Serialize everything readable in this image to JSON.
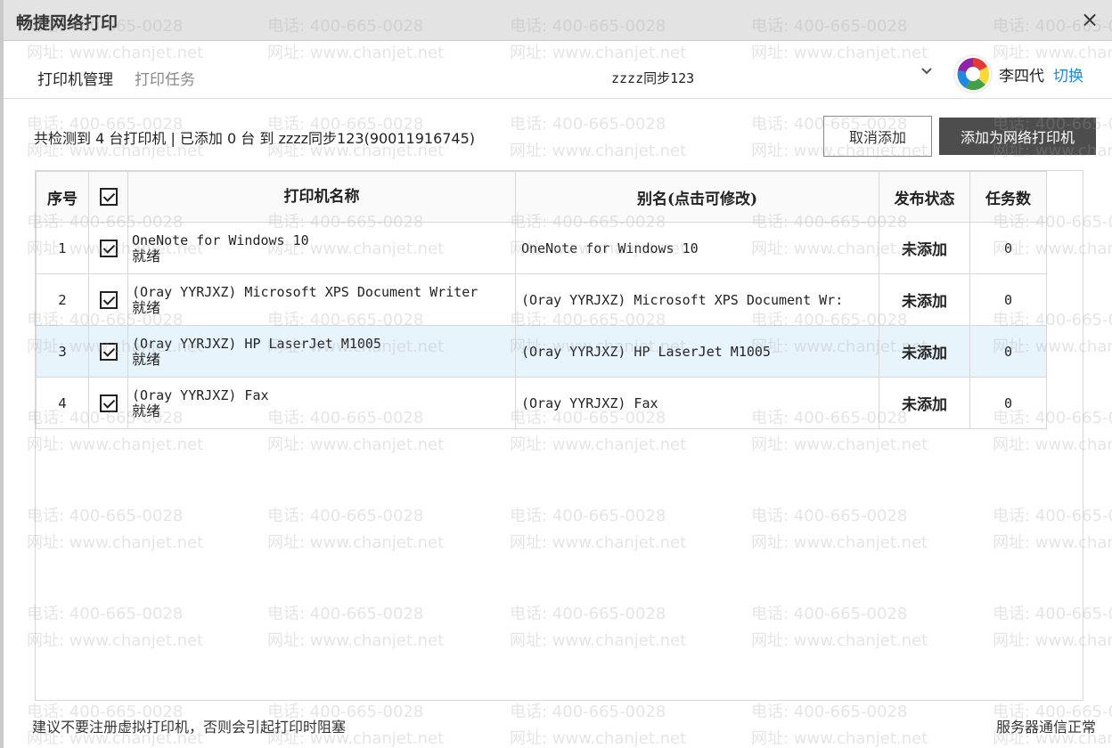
{
  "window": {
    "title": "畅捷网络打印",
    "close_glyph": "×"
  },
  "nav": {
    "tabs": [
      {
        "label": "打印机管理",
        "active": true
      },
      {
        "label": "打印任务",
        "active": false
      }
    ],
    "account": "zzzz同步123",
    "user_name": "李四代",
    "switch_label": "切换"
  },
  "summary": {
    "text": "共检测到 4 台打印机 | 已添加 0 台 到 zzzz同步123(90011916745)"
  },
  "actions": {
    "cancel_label": "取消添加",
    "add_label": "添加为网络打印机"
  },
  "table": {
    "headers": {
      "index": "序号",
      "name": "打印机名称",
      "alias": "别名(点击可修改)",
      "status": "发布状态",
      "tasks": "任务数"
    },
    "rows": [
      {
        "index": "1",
        "name": "OneNote for Windows 10",
        "state": "就绪",
        "alias": "OneNote for Windows 10",
        "status": "未添加",
        "tasks": "0",
        "checked": true
      },
      {
        "index": "2",
        "name": "(Oray YYRJXZ) Microsoft XPS Document Writer",
        "state": "就绪",
        "alias": "(Oray YYRJXZ) Microsoft XPS Document Wr:",
        "status": "未添加",
        "tasks": "0",
        "checked": true
      },
      {
        "index": "3",
        "name": "(Oray YYRJXZ) HP LaserJet M1005",
        "state": "就绪",
        "alias": "(Oray YYRJXZ) HP LaserJet M1005",
        "status": "未添加",
        "tasks": "0",
        "checked": true
      },
      {
        "index": "4",
        "name": "(Oray YYRJXZ) Fax",
        "state": "就绪",
        "alias": "(Oray YYRJXZ) Fax",
        "status": "未添加",
        "tasks": "0",
        "checked": true
      }
    ]
  },
  "footer": {
    "hint": "建议不要注册虚拟打印机，否则会引起打印时阻塞",
    "server_status": "服务器通信正常"
  },
  "watermark": {
    "phone": "电话: 400-665-0028",
    "site": "网址: www.chanjet.net"
  },
  "colors": {
    "accent_link": "#1e88e5",
    "primary_button": "#4d4d4d",
    "selected_row": "#e8f4fc"
  }
}
